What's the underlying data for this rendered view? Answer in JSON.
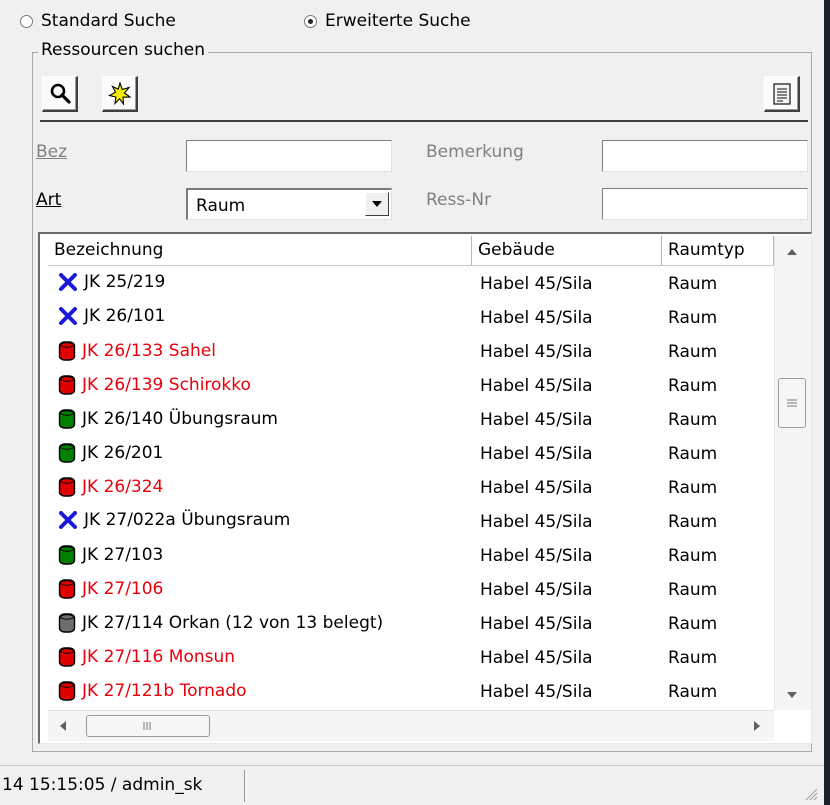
{
  "search_mode": {
    "standard_label": "Standard Suche",
    "extended_label": "Erweiterte Suche",
    "selected": "extended"
  },
  "group": {
    "title": "Ressourcen suchen"
  },
  "toolbar": {
    "search_icon": "magnifier-icon",
    "new_icon": "starburst-icon",
    "report_icon": "document-icon"
  },
  "filters": {
    "bez_label": "Bez",
    "bez_value": "",
    "bemerkung_label": "Bemerkung",
    "bemerkung_value": "",
    "art_label": "Art",
    "art_value": "Raum",
    "ressnr_label": "Ress-Nr",
    "ressnr_value": ""
  },
  "table": {
    "columns": [
      "Bezeichnung",
      "Gebäude",
      "Raumtyp"
    ],
    "rows": [
      {
        "status": "x-blue",
        "name": "JK 25/219",
        "building": "Habel 45/Sila",
        "type": "Raum",
        "highlight": false
      },
      {
        "status": "x-blue",
        "name": "JK 26/101",
        "building": "Habel 45/Sila",
        "type": "Raum",
        "highlight": false
      },
      {
        "status": "red",
        "name": "JK 26/133 Sahel",
        "building": "Habel 45/Sila",
        "type": "Raum",
        "highlight": true
      },
      {
        "status": "red",
        "name": "JK 26/139 Schirokko",
        "building": "Habel 45/Sila",
        "type": "Raum",
        "highlight": true
      },
      {
        "status": "green",
        "name": "JK 26/140 Übungsraum",
        "building": "Habel 45/Sila",
        "type": "Raum",
        "highlight": false
      },
      {
        "status": "green",
        "name": "JK 26/201",
        "building": "Habel 45/Sila",
        "type": "Raum",
        "highlight": false
      },
      {
        "status": "red",
        "name": "JK 26/324",
        "building": "Habel 45/Sila",
        "type": "Raum",
        "highlight": true
      },
      {
        "status": "x-blue",
        "name": "JK 27/022a Übungsraum",
        "building": "Habel 45/Sila",
        "type": "Raum",
        "highlight": false
      },
      {
        "status": "green",
        "name": "JK 27/103",
        "building": "Habel 45/Sila",
        "type": "Raum",
        "highlight": false
      },
      {
        "status": "red",
        "name": "JK 27/106",
        "building": "Habel 45/Sila",
        "type": "Raum",
        "highlight": true
      },
      {
        "status": "gray",
        "name": "JK 27/114 Orkan (12 von 13 belegt)",
        "building": "Habel 45/Sila",
        "type": "Raum",
        "highlight": false
      },
      {
        "status": "red",
        "name": "JK 27/116 Monsun",
        "building": "Habel 45/Sila",
        "type": "Raum",
        "highlight": true
      },
      {
        "status": "red",
        "name": "JK 27/121b Tornado",
        "building": "Habel 45/Sila",
        "type": "Raum",
        "highlight": true
      }
    ]
  },
  "status_bar": {
    "text": "14 15:15:05 / admin_sk"
  },
  "colors": {
    "highlight_text": "#e8000a",
    "status_red": "#e00000",
    "status_green": "#008000",
    "status_gray": "#6e6e6e",
    "status_x": "#1a1ad8"
  }
}
